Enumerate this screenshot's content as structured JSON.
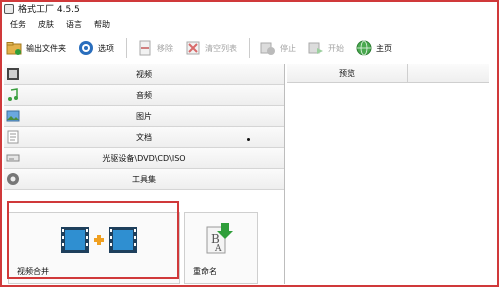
{
  "window": {
    "title": "格式工厂 4.5.5"
  },
  "menu": [
    "任务",
    "皮肤",
    "语言",
    "帮助"
  ],
  "toolbar": {
    "output_folder": "输出文件夹",
    "options": "选项",
    "remove": "移除",
    "clear_list": "清空列表",
    "stop": "停止",
    "start": "开始",
    "home": "主页"
  },
  "categories": [
    "视频",
    "音频",
    "图片",
    "文档",
    "光驱设备\\DVD\\CD\\ISO",
    "工具集"
  ],
  "tools": {
    "video_merge": "视频合并",
    "rename": "重命名"
  },
  "preview": {
    "header": "预览"
  },
  "colors": {
    "highlight": "#d0393a",
    "accent_green": "#2f9e3a",
    "accent_orange": "#f0a020"
  }
}
